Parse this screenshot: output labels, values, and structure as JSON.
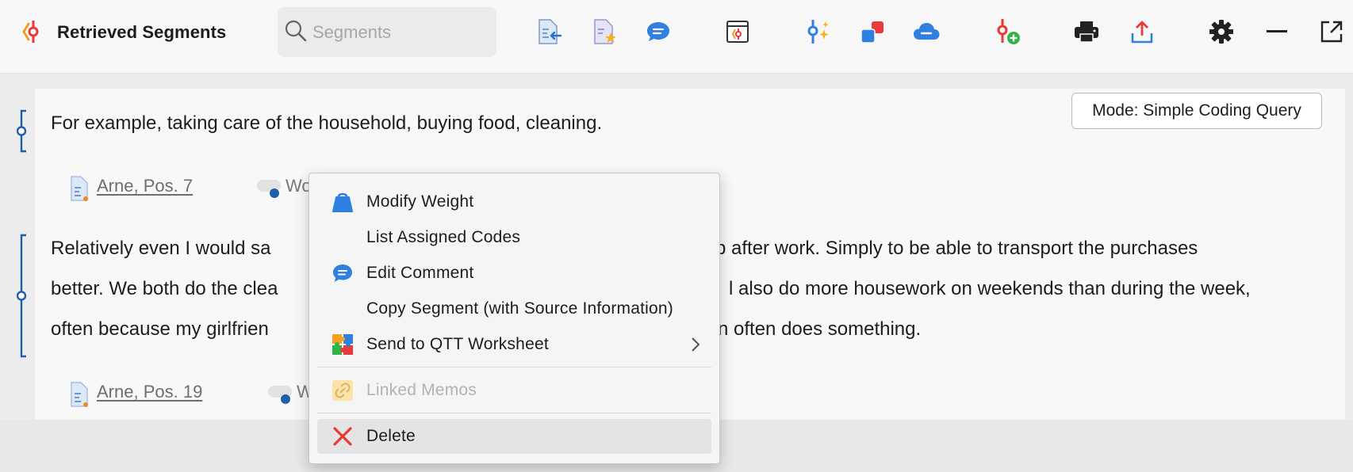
{
  "toolbar": {
    "title": "Retrieved Segments",
    "search_placeholder": "Segments",
    "icons": [
      "codes-icon",
      "import-doc-icon",
      "favorite-doc-icon",
      "comment-icon",
      "activate-icon",
      "code-magic-icon",
      "color-squares-icon",
      "cloud-icon",
      "add-code-icon",
      "print-icon",
      "export-icon",
      "settings-icon",
      "minimize-icon",
      "popout-icon"
    ]
  },
  "mode_label": "Mode: Simple Coding Query",
  "segments": [
    {
      "text": "For example, taking care of the household, buying food, cleaning.",
      "source": "Arne, Pos. 7",
      "weight_partial": "Wo"
    },
    {
      "line1": "Relatively even I would sa",
      "line1_right": "p after work. Simply to be able to transport the purchases",
      "line2": "better. We both do the clea",
      "line2_right": "l also do more housework on weekends than during the week,",
      "line3": "often because my girlfrien",
      "line3_right": "n often does something.",
      "source": "Arne, Pos. 19",
      "weight_partial": "W"
    }
  ],
  "context_menu": {
    "items": [
      {
        "label": "Modify Weight",
        "icon": "weight-icon"
      },
      {
        "label": "List Assigned Codes"
      },
      {
        "label": "Edit Comment",
        "icon": "comment-icon"
      },
      {
        "label": "Copy Segment (with Source Information)"
      },
      {
        "label": "Send to QTT Worksheet",
        "icon": "qtt-puzzle-icon",
        "submenu": true
      },
      {
        "label": "Linked Memos",
        "icon": "link-memo-icon",
        "disabled": true
      },
      {
        "label": "Delete",
        "icon": "delete-x-icon"
      }
    ]
  },
  "colors": {
    "accent_blue": "#3a86d8",
    "code_line": "#1f5fa8",
    "delete_red": "#e5393a"
  }
}
